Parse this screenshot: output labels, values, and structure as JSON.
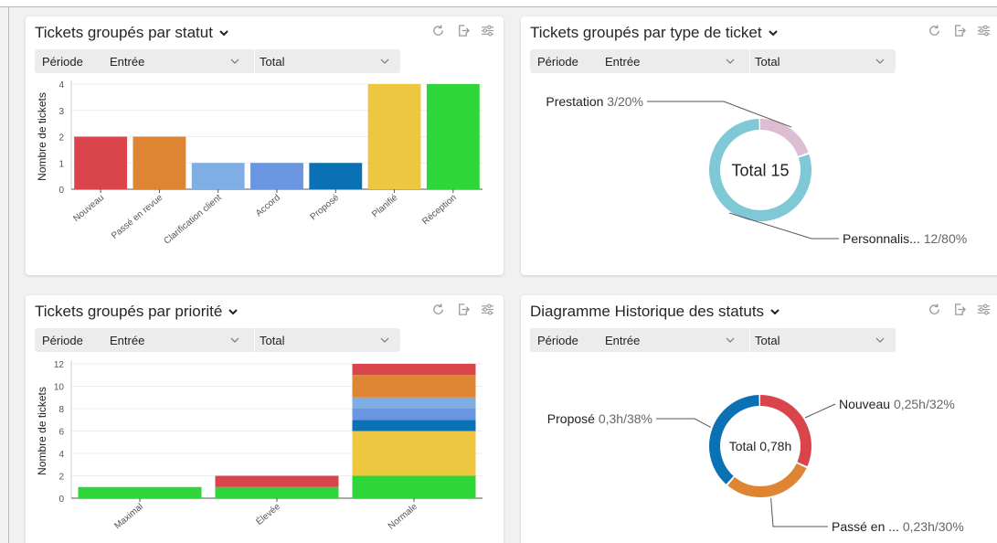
{
  "filters": {
    "label": "Période",
    "select1": "Entrée",
    "select2": "Total"
  },
  "chart_data": [
    {
      "type": "bar",
      "title": "Tickets groupés  par statut",
      "ylabel": "Nombre de tickets",
      "xlabel": "",
      "ylim": [
        0,
        4
      ],
      "yticks": [
        0,
        1,
        2,
        3,
        4
      ],
      "categories": [
        "Nouveau",
        "Passé en revue",
        "Clarification client",
        "Accord",
        "Proposé",
        "Planifié",
        "Réception"
      ],
      "values": [
        2,
        2,
        1,
        1,
        1,
        4,
        4
      ],
      "colors": [
        "#d9454b",
        "#dd8533",
        "#7eaee3",
        "#6a95e0",
        "#0a71b5",
        "#ecc73f",
        "#2ed63a"
      ]
    },
    {
      "type": "pie",
      "title": "Tickets groupés  par type de ticket",
      "center_label": "Total 15",
      "slices": [
        {
          "name": "Prestation",
          "value": 3,
          "pct": 20,
          "label": "3/20%",
          "color": "#dcbdd1"
        },
        {
          "name": "Personnalis...",
          "value": 12,
          "pct": 80,
          "label": "12/80%",
          "color": "#7ec9d5"
        }
      ]
    },
    {
      "type": "bar",
      "stacked": true,
      "title": "Tickets groupés  par priorité",
      "ylabel": "Nombre de tickets",
      "xlabel": "",
      "ylim": [
        0,
        12
      ],
      "yticks": [
        0,
        2,
        4,
        6,
        8,
        10,
        12
      ],
      "categories": [
        "Maximal",
        "Élevée",
        "Normale"
      ],
      "series": [
        {
          "values": [
            1,
            1,
            2
          ],
          "color": "#2ed63a"
        },
        {
          "values": [
            0,
            0,
            4
          ],
          "color": "#ecc73f"
        },
        {
          "values": [
            0,
            0,
            1
          ],
          "color": "#0a71b5"
        },
        {
          "values": [
            0,
            0,
            1
          ],
          "color": "#6a95e0"
        },
        {
          "values": [
            0,
            0,
            1
          ],
          "color": "#7eaee3"
        },
        {
          "values": [
            0,
            0,
            2
          ],
          "color": "#dd8533"
        },
        {
          "values": [
            0,
            1,
            1
          ],
          "color": "#d9454b"
        }
      ]
    },
    {
      "type": "pie",
      "title": "Diagramme Historique des statuts",
      "center_label": "Total 0,78h",
      "slices": [
        {
          "name": "Nouveau",
          "value": 0.25,
          "pct": 32,
          "label": "0,25h/32%",
          "color": "#d9454b"
        },
        {
          "name": "Passé en ...",
          "value": 0.23,
          "pct": 30,
          "label": "0,23h/30%",
          "color": "#dd8533"
        },
        {
          "name": "Proposé",
          "value": 0.3,
          "pct": 38,
          "label": "0,3h/38%",
          "color": "#0a71b5"
        }
      ]
    }
  ]
}
